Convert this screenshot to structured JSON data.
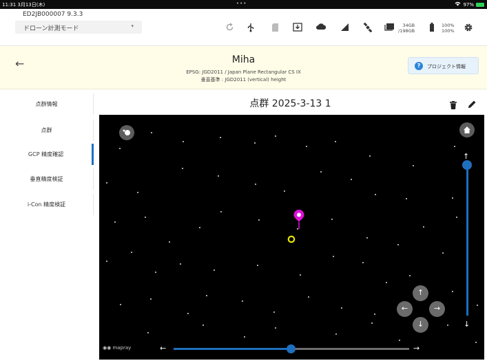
{
  "status_bar": {
    "time": "11:31 3月13日(木)",
    "dots": "•••",
    "battery_percent": "97%"
  },
  "toolbar": {
    "device_id": "ED2JB000007   9.3.3",
    "mode": "ドローン計測モード",
    "icons": [
      "refresh-icon",
      "usb-icon",
      "sd-card-icon",
      "download-icon",
      "cloud-icon",
      "signal-icon",
      "satellite-icon",
      "storage-icon",
      "battery-icon",
      "settings-icon"
    ],
    "storage_line1": "34GB",
    "storage_line2": "/198GB",
    "battery_line1": "100%",
    "battery_line2": "100%"
  },
  "project": {
    "title": "Miha",
    "crs": "EPSG: JGD2011 / Japan Plane Rectangular CS IX",
    "vertical": "垂直基準 : JGD2011 (vertical) height",
    "info_button": "プロジェクト情報"
  },
  "sidebar": {
    "items": [
      {
        "label": "点群情報",
        "active": false
      },
      {
        "label": "点群",
        "active": false
      },
      {
        "label": "GCP 精度確認",
        "active": true
      },
      {
        "label": "垂直精度検証",
        "active": false
      },
      {
        "label": "i-Con 精度検証",
        "active": false
      }
    ]
  },
  "content": {
    "title": "点群 2025-3-13 1"
  },
  "map": {
    "logo": "mapray",
    "marker_color": "#e010d8",
    "target_color": "#e6e600",
    "slider_color": "#1f6fbf",
    "vertical_slider_level": 0.0,
    "horizontal_slider_level": 0.5
  }
}
